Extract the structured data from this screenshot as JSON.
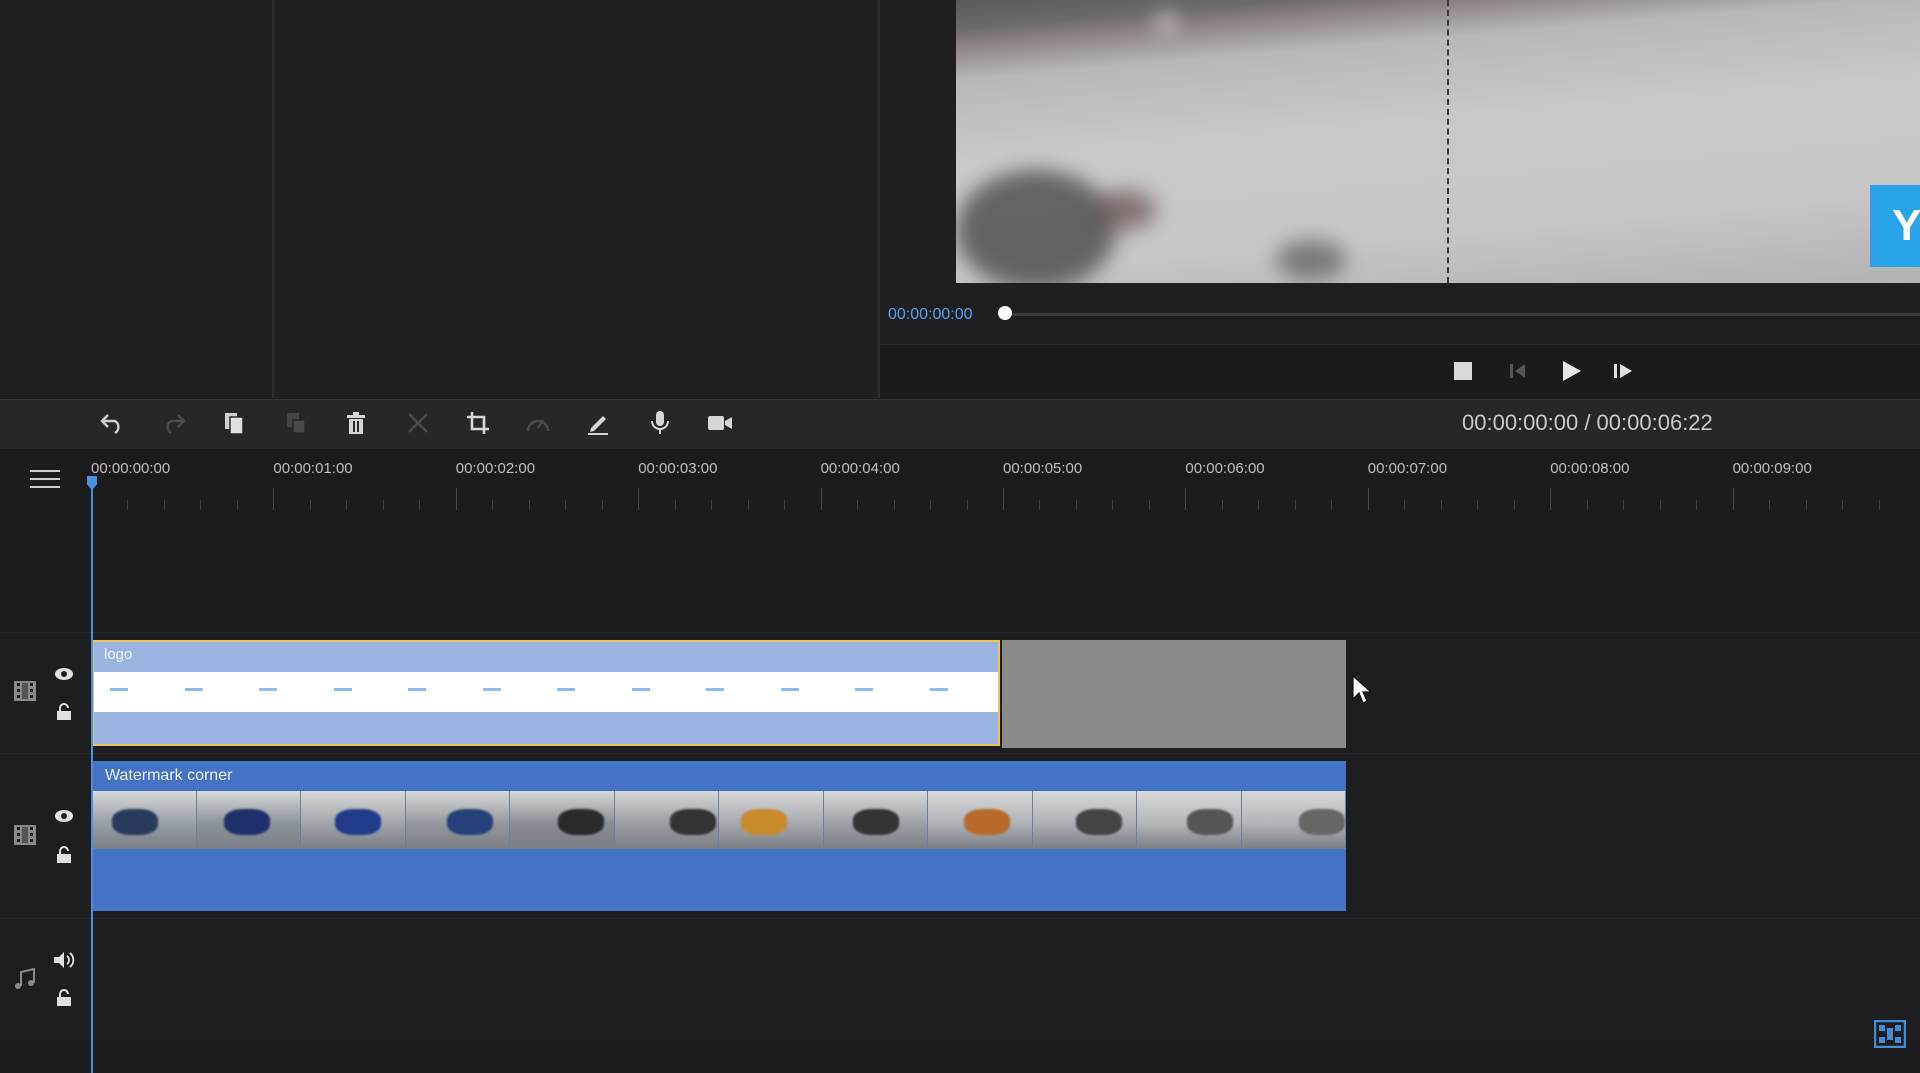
{
  "preview": {
    "current_time": "00:00:00:00",
    "logo_letter": "Y"
  },
  "playback": {
    "stop_icon": "stop-icon",
    "prev_frame_icon": "prev-frame-icon",
    "play_icon": "play-icon",
    "next_frame_icon": "next-frame-icon"
  },
  "toolbar": {
    "icons": [
      "undo-icon",
      "redo-icon",
      "copy-icon",
      "paste-icon",
      "delete-icon",
      "split-icon",
      "crop-icon",
      "speed-icon",
      "edit-icon",
      "microphone-icon",
      "camera-icon"
    ],
    "time_readout": "00:00:00:00 / 00:00:06:22"
  },
  "ruler": {
    "labels": [
      "00:00:00:00",
      "00:00:01:00",
      "00:00:02:00",
      "00:00:03:00",
      "00:00:04:00",
      "00:00:05:00",
      "00:00:06:00",
      "00:00:07:00",
      "00:00:08:00",
      "00:00:09:00"
    ]
  },
  "tracks": {
    "logo_clip_title": "logo",
    "video_clip_title": "Watermark corner"
  },
  "colors": {
    "accent": "#4a90e2",
    "video_clip": "#4472c4",
    "logo_clip": "#9bb3e0",
    "selection_border": "#e8c45a"
  }
}
